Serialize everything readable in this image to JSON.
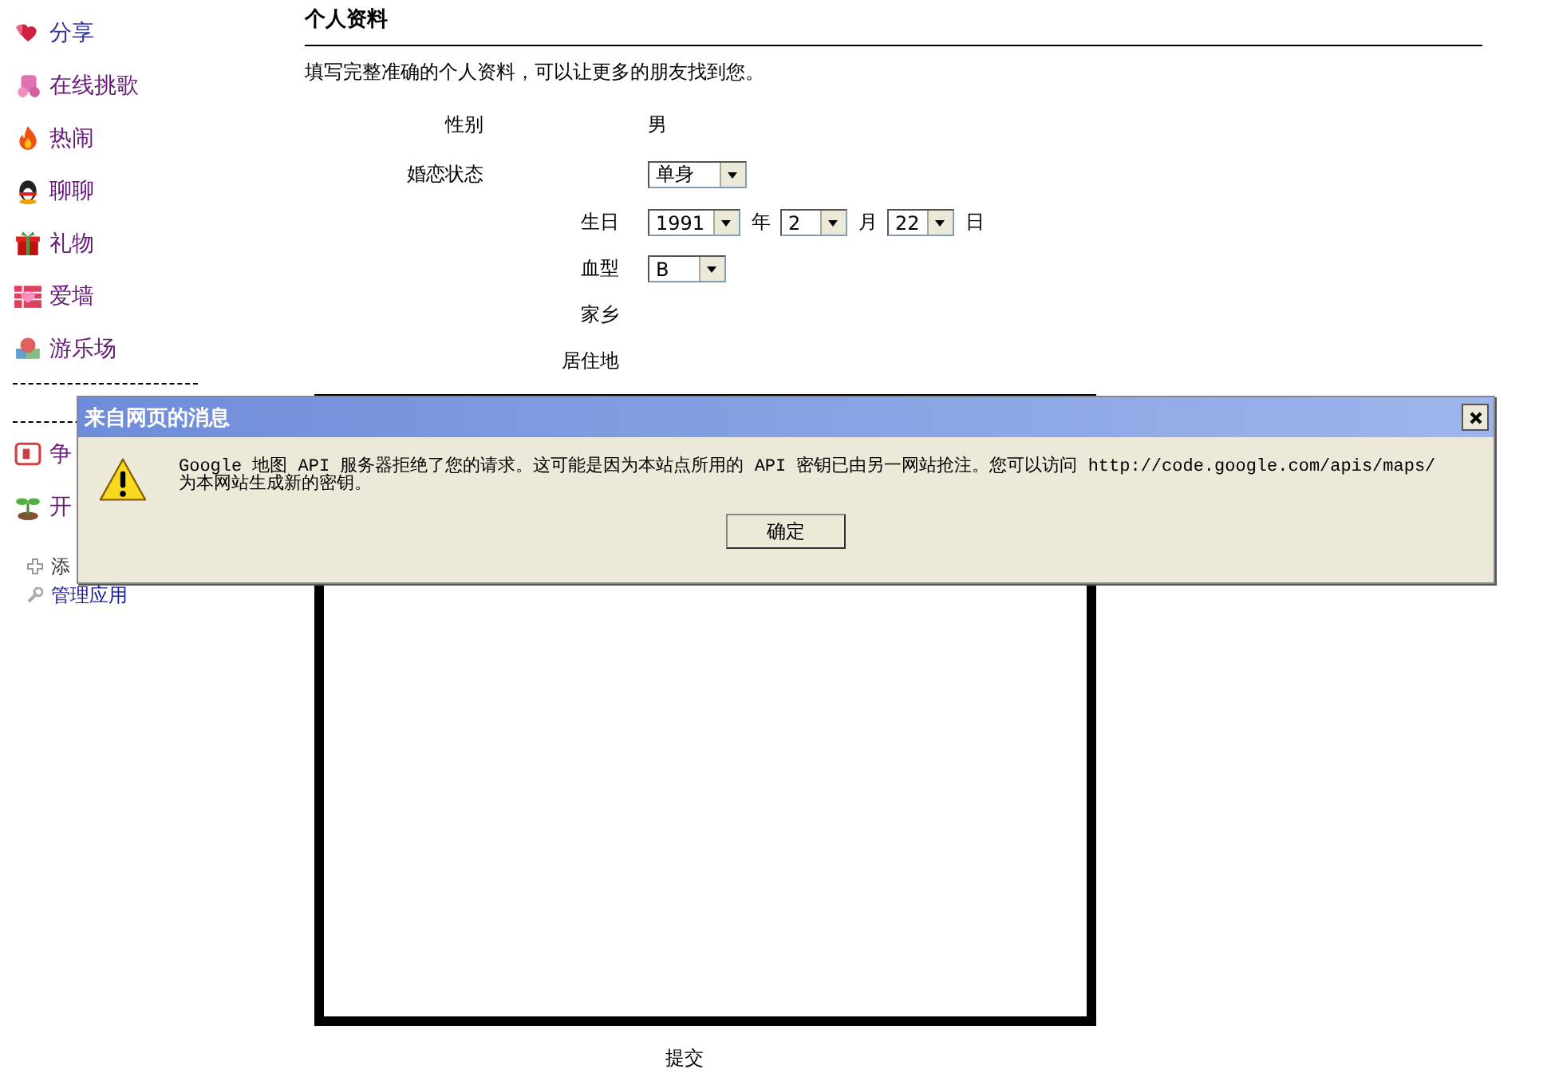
{
  "sidebar": {
    "apps": [
      {
        "label": "分享"
      },
      {
        "label": "在线挑歌"
      },
      {
        "label": "热闹"
      },
      {
        "label": "聊聊"
      },
      {
        "label": "礼物"
      },
      {
        "label": "爱墙"
      },
      {
        "label": "游乐场"
      }
    ],
    "apps_more": [
      {
        "label": "争"
      },
      {
        "label": "开"
      }
    ],
    "links": [
      {
        "label": "添"
      },
      {
        "label": "管理应用"
      }
    ]
  },
  "profile": {
    "title": "个人资料",
    "intro": "填写完整准确的个人资料，可以让更多的朋友找到您。",
    "fields": [
      {
        "label": "性别",
        "kind": "text",
        "value": "男"
      },
      {
        "label": "婚恋状态",
        "kind": "select",
        "value": "单身"
      },
      {
        "label": "生日",
        "kind": "date",
        "year": "1991",
        "year_unit": "年",
        "month": "2",
        "month_unit": "月",
        "day": "22",
        "day_unit": "日"
      },
      {
        "label": "血型",
        "kind": "select",
        "value": "B"
      },
      {
        "label": "家乡",
        "kind": "empty"
      },
      {
        "label": "居住地",
        "kind": "empty"
      }
    ],
    "submit": "提交"
  },
  "dialog": {
    "title": "来自网页的消息",
    "message": "Google 地图 API 服务器拒绝了您的请求。这可能是因为本站点所用的 API 密钥已由另一网站抢注。您可以访问 http://code.google.com/apis/maps/ 为本网站生成新的密钥。",
    "ok": "确定"
  }
}
